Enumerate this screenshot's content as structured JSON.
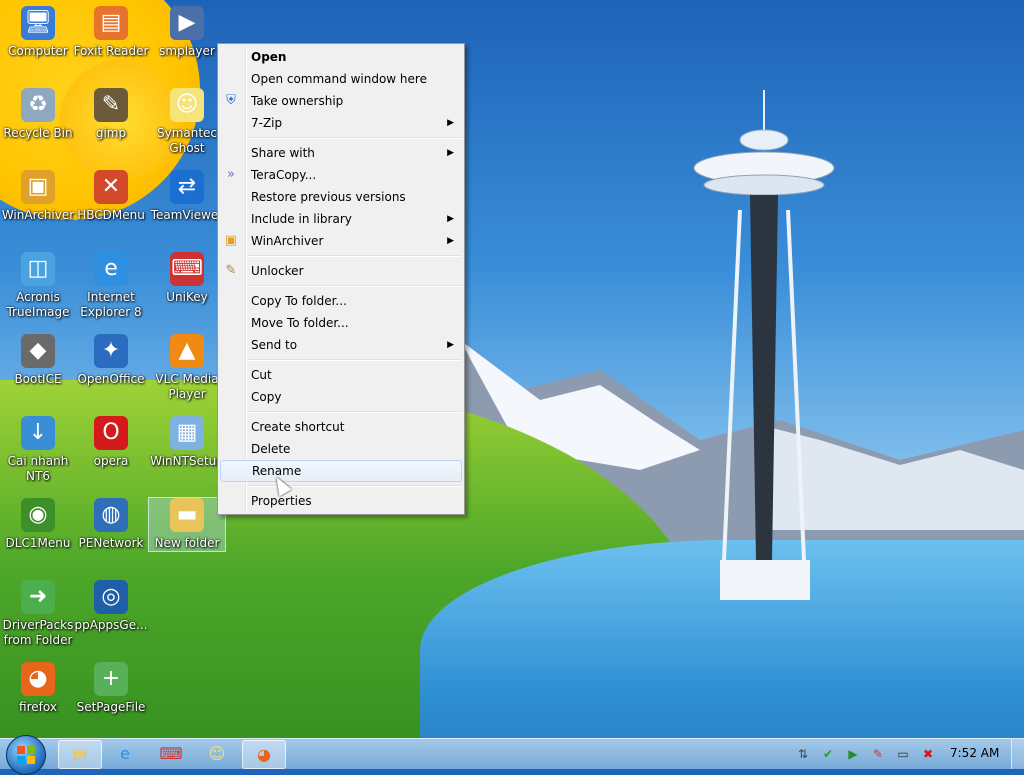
{
  "desktop": {
    "icons": [
      {
        "label": "Computer",
        "icon": "computer-icon"
      },
      {
        "label": "Foxit Reader",
        "icon": "pdf-icon"
      },
      {
        "label": "smplayer",
        "icon": "media-player-icon"
      },
      {
        "label": "Recycle Bin",
        "icon": "recycle-bin-icon"
      },
      {
        "label": "gimp",
        "icon": "gimp-icon"
      },
      {
        "label": "Symantec Ghost",
        "icon": "ghost-icon"
      },
      {
        "label": "WinArchiver",
        "icon": "archive-icon"
      },
      {
        "label": "HBCDMenu",
        "icon": "tools-icon"
      },
      {
        "label": "TeamViewer",
        "icon": "teamviewer-icon"
      },
      {
        "label": "Acronis TrueImage",
        "icon": "acronis-icon"
      },
      {
        "label": "Internet Explorer 8",
        "icon": "ie-icon"
      },
      {
        "label": "UniKey",
        "icon": "keyboard-icon"
      },
      {
        "label": "BootICE",
        "icon": "bootice-icon"
      },
      {
        "label": "OpenOffice",
        "icon": "openoffice-icon"
      },
      {
        "label": "VLC Media Player",
        "icon": "vlc-icon"
      },
      {
        "label": "Cai nhanh NT6",
        "icon": "setup-icon"
      },
      {
        "label": "opera",
        "icon": "opera-icon"
      },
      {
        "label": "WinNTSetup",
        "icon": "winntsetup-icon"
      },
      {
        "label": "DLC1Menu",
        "icon": "dlc-icon"
      },
      {
        "label": "PENetwork",
        "icon": "network-icon"
      },
      {
        "label": "New folder",
        "icon": "folder-icon"
      },
      {
        "label": "DriverPacks from Folder",
        "icon": "driverpacks-icon"
      },
      {
        "label": "ppAppsGe...",
        "icon": "ppapps-icon"
      },
      {
        "label": "firefox",
        "icon": "firefox-icon"
      },
      {
        "label": "SetPageFile",
        "icon": "setpagefile-icon"
      }
    ]
  },
  "context_menu": {
    "items": [
      {
        "label": "Open",
        "bold": true
      },
      {
        "label": "Open command window here"
      },
      {
        "label": "Take ownership",
        "icon": "shield-icon"
      },
      {
        "label": "7-Zip",
        "submenu": true
      },
      {
        "separator": true
      },
      {
        "label": "Share with",
        "submenu": true
      },
      {
        "label": "TeraCopy...",
        "icon": "teracopy-icon"
      },
      {
        "label": "Restore previous versions"
      },
      {
        "label": "Include in library",
        "submenu": true
      },
      {
        "label": "WinArchiver",
        "icon": "winarchiver-icon",
        "submenu": true
      },
      {
        "separator": true
      },
      {
        "label": "Unlocker",
        "icon": "unlocker-icon"
      },
      {
        "separator": true
      },
      {
        "label": "Copy To folder..."
      },
      {
        "label": "Move To folder..."
      },
      {
        "label": "Send to",
        "submenu": true
      },
      {
        "separator": true
      },
      {
        "label": "Cut"
      },
      {
        "label": "Copy"
      },
      {
        "separator": true
      },
      {
        "label": "Create shortcut"
      },
      {
        "label": "Delete"
      },
      {
        "label": "Rename",
        "hovered": true
      },
      {
        "separator": true
      },
      {
        "label": "Properties"
      }
    ]
  },
  "taskbar": {
    "start_icon": "windows-logo-icon",
    "pinned": [
      {
        "icon": "explorer-icon",
        "active": true
      },
      {
        "icon": "ie-icon"
      },
      {
        "icon": "unikey-icon"
      },
      {
        "icon": "ghost-icon"
      },
      {
        "icon": "firefox-icon",
        "active": true
      }
    ],
    "tray_icons": [
      "network-tray-icon",
      "shield-tray-icon",
      "media-tray-icon",
      "app-tray-icon",
      "display-tray-icon",
      "volume-muted-icon"
    ],
    "clock": "7:52 AM"
  },
  "colors": {
    "menu_bg": "#f0f0f0",
    "hover_border": "#b8d6fb",
    "taskbar": "#9ec3e6"
  }
}
